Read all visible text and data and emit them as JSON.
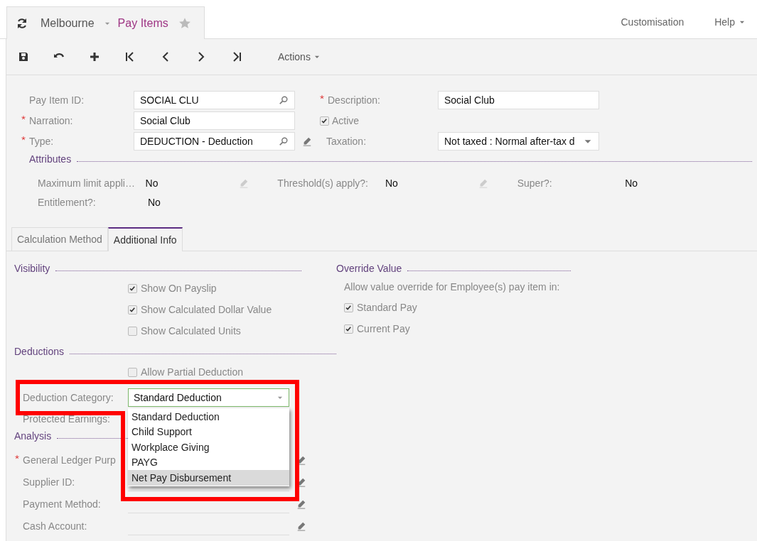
{
  "header": {
    "company": "Melbourne",
    "screen": "Pay Items",
    "links": [
      {
        "label": "Customisation",
        "kind": "link"
      },
      {
        "label": "Help",
        "kind": "menu"
      }
    ]
  },
  "toolbar": {
    "buttons": [
      {
        "kind": "save"
      },
      {
        "kind": "undo"
      },
      {
        "kind": "add"
      },
      {
        "kind": "first"
      },
      {
        "kind": "prev"
      },
      {
        "kind": "next"
      },
      {
        "kind": "last"
      }
    ],
    "actions": "Actions"
  },
  "summary": {
    "fields": [
      {
        "label": "Pay Item ID:",
        "required": false,
        "value": "SOCIAL CLU",
        "kind": "lookup"
      },
      {
        "label": "Narration:",
        "required": true,
        "value": "Social Club",
        "kind": "text"
      },
      {
        "label": "Type:",
        "required": true,
        "value": "DEDUCTION - Deduction",
        "kind": "lookup",
        "edit_icon": {
          "disabled": false
        }
      }
    ],
    "description": {
      "label": "Description:",
      "required": true,
      "value": "Social Club"
    },
    "active": {
      "label": "Active",
      "checked": true
    },
    "taxation": {
      "label": "Taxation:",
      "value": "Not taxed : Normal after-tax d"
    }
  },
  "attributes": {
    "title": "Attributes",
    "rows": [
      {
        "items": [
          {
            "label": "Maximum limit appli…",
            "value": "No",
            "edit_icon": {
              "disabled": true
            }
          },
          {
            "label": "Threshold(s) apply?:",
            "value": "No",
            "edit_icon": {
              "disabled": true
            }
          },
          {
            "label": "Super?:",
            "value": "No"
          }
        ]
      },
      {
        "items": [
          {
            "label": "Entitlement?:",
            "value": "No"
          }
        ]
      }
    ]
  },
  "tabs": [
    {
      "label": "Calculation Method",
      "selected": false
    },
    {
      "label": "Additional Info",
      "selected": true
    }
  ],
  "visibility": {
    "title": "Visibility",
    "options": [
      {
        "label": "Show On Payslip",
        "checked": true
      },
      {
        "label": "Show Calculated Dollar Value",
        "checked": true
      },
      {
        "label": "Show Calculated Units",
        "checked": false
      }
    ]
  },
  "override": {
    "title": "Override Value",
    "note": "Allow value override for Employee(s) pay item in:",
    "options": [
      {
        "label": "Standard Pay",
        "checked": true
      },
      {
        "label": "Current Pay",
        "checked": true
      }
    ]
  },
  "deductions": {
    "title": "Deductions",
    "options": [
      {
        "label": "Allow Partial Deduction",
        "checked": false
      }
    ],
    "category": {
      "label": "Deduction Category:",
      "value": "Standard Deduction",
      "expanded": true,
      "options": [
        {
          "label": "Standard Deduction",
          "highlighted": false
        },
        {
          "label": "Child Support",
          "highlighted": false
        },
        {
          "label": "Workplace Giving",
          "highlighted": false
        },
        {
          "label": "PAYG",
          "highlighted": false
        },
        {
          "label": "Net Pay Disbursement",
          "highlighted": true
        }
      ]
    },
    "protected": {
      "label": "Protected Earnings:"
    }
  },
  "analysis": {
    "title": "Analysis",
    "fields": [
      {
        "label": "General Ledger Purp",
        "required": true,
        "edit_icon": {
          "disabled": false
        }
      },
      {
        "label": "Supplier ID:",
        "required": false,
        "edit_icon": {
          "disabled": false
        }
      },
      {
        "label": "Payment Method:",
        "required": false,
        "edit_icon": {
          "disabled": false
        }
      },
      {
        "label": "Cash Account:",
        "required": false,
        "edit_icon": {
          "disabled": false
        }
      }
    ]
  }
}
